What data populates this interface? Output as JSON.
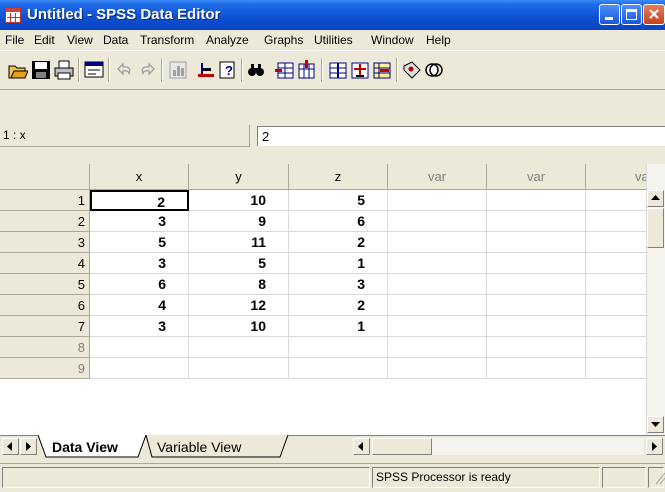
{
  "window": {
    "title": "Untitled - SPSS Data Editor"
  },
  "menu": [
    "File",
    "Edit",
    "View",
    "Data",
    "Transform",
    "Analyze",
    "Graphs",
    "Utilities",
    "Window",
    "Help"
  ],
  "toolbar": {
    "buttons": [
      "open-icon",
      "save-icon",
      "print-icon",
      "dialog-recall-icon",
      "undo-icon",
      "redo-icon",
      "goto-chart-icon",
      "goto-case-icon",
      "variables-icon",
      "find-icon",
      "insert-cases-icon",
      "insert-variable-icon",
      "split-file-icon",
      "weight-cases-icon",
      "select-cases-icon",
      "value-labels-icon",
      "use-sets-icon"
    ]
  },
  "cell_editor": {
    "reference": "1 : x",
    "value": "2"
  },
  "grid": {
    "columns": [
      "x",
      "y",
      "z",
      "var",
      "var",
      "var"
    ],
    "row_numbers": [
      "1",
      "2",
      "3",
      "4",
      "5",
      "6",
      "7",
      "8",
      "9"
    ],
    "rows": [
      [
        "2",
        "10",
        "5"
      ],
      [
        "3",
        "9",
        "6"
      ],
      [
        "5",
        "11",
        "2"
      ],
      [
        "3",
        "5",
        "1"
      ],
      [
        "6",
        "8",
        "3"
      ],
      [
        "4",
        "12",
        "2"
      ],
      [
        "3",
        "10",
        "1"
      ]
    ]
  },
  "tabs": {
    "data_view": "Data View",
    "variable_view": "Variable View"
  },
  "status": {
    "processor": "SPSS Processor  is ready"
  }
}
